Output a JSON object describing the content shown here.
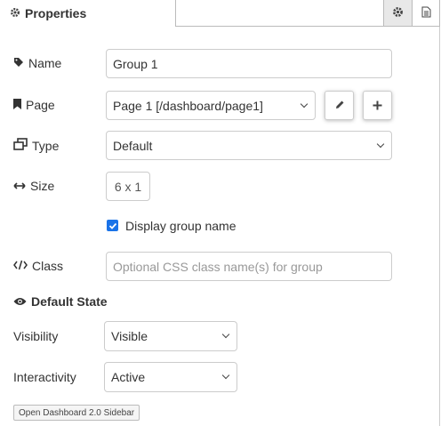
{
  "header": {
    "title": "Properties",
    "gear_icon": "gear-icon",
    "doc_icon": "document-icon"
  },
  "form": {
    "name": {
      "label": "Name",
      "value": "Group 1",
      "icon": "tag-icon"
    },
    "page": {
      "label": "Page",
      "value": "Page 1 [/dashboard/page1]",
      "icon": "bookmark-icon",
      "edit_icon": "pencil-icon",
      "add_icon": "plus-icon"
    },
    "type": {
      "label": "Type",
      "value": "Default",
      "icon": "window-restore-icon"
    },
    "size": {
      "label": "Size",
      "value": "6 x 1",
      "icon": "arrows-horizontal-icon"
    },
    "display_group_name": {
      "label": "Display group name",
      "checked": true
    },
    "class": {
      "label": "Class",
      "placeholder": "Optional CSS class name(s) for group",
      "icon": "code-icon"
    },
    "default_state": {
      "heading": "Default State",
      "icon": "eye-icon"
    },
    "visibility": {
      "label": "Visibility",
      "value": "Visible"
    },
    "interactivity": {
      "label": "Interactivity",
      "value": "Active"
    }
  },
  "footer": {
    "sidebar_button": "Open Dashboard 2.0 Sidebar"
  },
  "colors": {
    "accent": "#1a73e8",
    "border": "#cccccc",
    "text": "#333333"
  }
}
